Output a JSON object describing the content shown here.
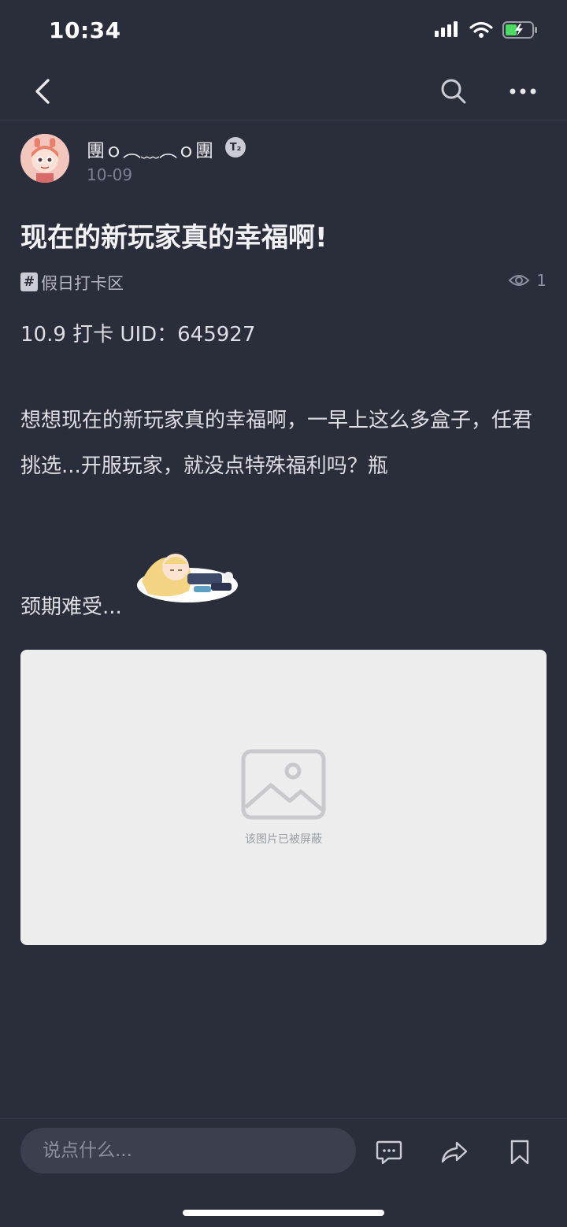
{
  "status_bar": {
    "time": "10:34"
  },
  "author": {
    "name": "團ｏ︵﹏︵ｏ團",
    "level_badge": "T₂",
    "date": "10-09"
  },
  "post": {
    "title": "现在的新玩家真的幸福啊!",
    "topic": "假日打卡区",
    "view_count": "1",
    "line_uid": "10.9  打卡  UID：645927",
    "paragraph": "想想现在的新玩家真的幸福啊，一早上这么多盒子，任君挑选...开服玩家，就没点特殊福利吗？瓶",
    "line_last": "颈期难受..."
  },
  "blocked_image": {
    "caption": "该图片已被屏蔽"
  },
  "bottom_bar": {
    "comment_placeholder": "说点什么..."
  },
  "icons": {
    "back": "chevron-left-icon",
    "search": "search-icon",
    "more": "more-horizontal-icon",
    "comment": "comment-icon",
    "share": "share-icon",
    "bookmark": "bookmark-icon"
  },
  "colors": {
    "background": "#2a2d3a",
    "input_bg": "#3b3f4e",
    "blocked_bg": "#ededee"
  }
}
